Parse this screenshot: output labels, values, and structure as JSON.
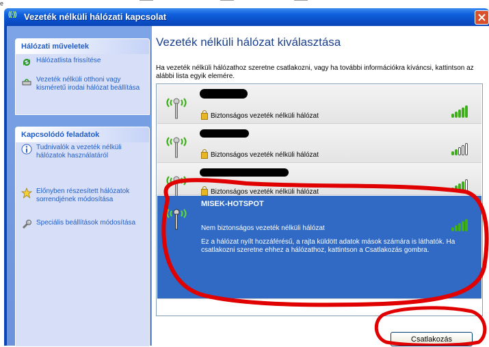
{
  "window": {
    "title": "Vezeték nélküli hálózati kapcsolat"
  },
  "sidebar": {
    "network_tasks": {
      "heading": "Hálózati műveletek",
      "items": [
        {
          "label": "Hálózatlista frissítése",
          "icon": "refresh-icon"
        },
        {
          "label": "Vezeték nélküli otthoni vagy kisméretű irodai hálózat beállítása",
          "icon": "network-setup-icon"
        }
      ]
    },
    "related_tasks": {
      "heading": "Kapcsolódó feladatok",
      "items": [
        {
          "label": "Tudnivalók a vezeték nélküli hálózatok használatáról",
          "icon": "info-icon"
        },
        {
          "label": "Előnyben részesített hálózatok sorrendjének módosítása",
          "icon": "star-icon"
        },
        {
          "label": "Speciális beállítások módosítása",
          "icon": "wrench-icon"
        }
      ]
    }
  },
  "main": {
    "title": "Vezeték nélküli hálózat kiválasztása",
    "intro": "Ha vezeték nélküli hálózathoz szeretne csatlakozni, vagy ha további információkra kíváncsi, kattintson az alábbi lista egyik elemére.",
    "networks": [
      {
        "security": "Biztonságos vezeték nélküli hálózat",
        "signal_bars": 5
      },
      {
        "security": "Biztonságos vezeték nélküli hálózat",
        "signal_bars": 2
      },
      {
        "security": "Biztonságos vezeték nélküli hálózat",
        "signal_bars": 4
      },
      {
        "name": "MISEK-HOTSPOT",
        "security": "Nem biztonságos vezeték nélküli hálózat",
        "signal_bars": 5,
        "description": "Ez a hálózat nyílt hozzáférésű, a rajta küldött adatok mások számára is láthatók. Ha csatlakozni szeretne ehhez a hálózathoz, kattintson a Csatlakozás gombra.",
        "selected": true
      }
    ],
    "connect_label": "Csatlakozás"
  },
  "colors": {
    "accent": "#316ac5",
    "title_bar": "#0a4fc8",
    "annotation": "#e00000",
    "signal": "#3fae1b"
  }
}
